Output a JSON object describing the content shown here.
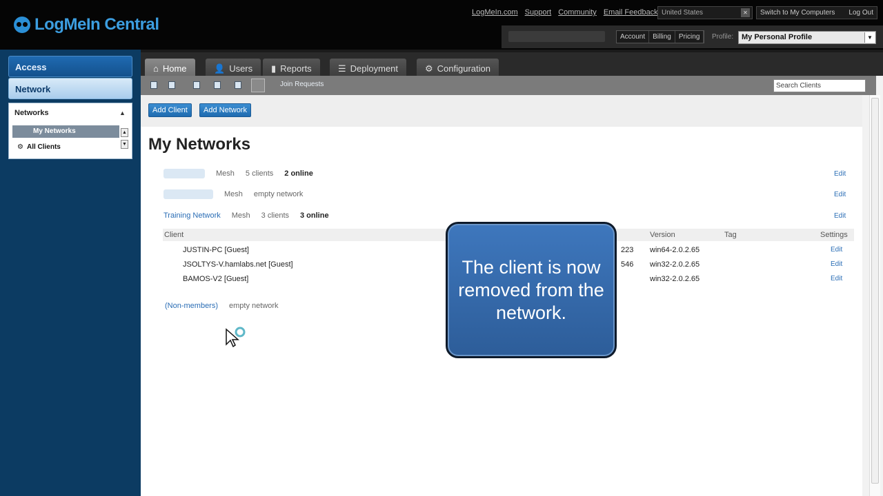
{
  "header": {
    "logo": "LogMeIn Central",
    "links": [
      "LogMeIn.com",
      "Support",
      "Community",
      "Email Feedback"
    ],
    "country": "United States",
    "switch_label": "Switch to My Computers",
    "logout": "Log Out",
    "account_links": [
      "Account",
      "Billing",
      "Pricing"
    ],
    "profile_label": "Profile:",
    "profile_value": "My Personal Profile"
  },
  "sidebar": {
    "access": "Access",
    "network": "Network",
    "panel_title": "Networks",
    "items": [
      "My Networks",
      "All Clients"
    ]
  },
  "tabs": [
    "Home",
    "Users",
    "Reports",
    "Deployment",
    "Configuration"
  ],
  "toolbar": {
    "join_requests": "Join Requests",
    "search_placeholder": "Search Clients"
  },
  "buttons": {
    "add_client": "Add Client",
    "add_network": "Add Network"
  },
  "page": {
    "title": "My Networks",
    "networks": [
      {
        "type": "Mesh",
        "clients": "5 clients",
        "online": "2 online",
        "edit": "Edit"
      },
      {
        "type": "Mesh",
        "clients": "empty network",
        "online": "",
        "edit": "Edit"
      },
      {
        "name": "Training Network",
        "type": "Mesh",
        "clients": "3 clients",
        "online": "3 online",
        "edit": "Edit"
      }
    ],
    "table_headers": {
      "client": "Client",
      "version": "Version",
      "tag": "Tag",
      "settings": "Settings"
    },
    "rows": [
      {
        "client": "JUSTIN-PC [Guest]",
        "partial": "223",
        "version": "win64-2.0.2.65",
        "edit": "Edit"
      },
      {
        "client": "JSOLTYS-V.hamlabs.net [Guest]",
        "partial": "546",
        "version": "win32-2.0.2.65",
        "edit": "Edit"
      },
      {
        "client": "BAMOS-V2 [Guest]",
        "partial": "",
        "version": "win32-2.0.2.65",
        "edit": "Edit"
      }
    ],
    "non_members": "(Non-members)",
    "non_members_status": "empty network"
  },
  "callout": {
    "text": "The client is now removed from the network."
  }
}
